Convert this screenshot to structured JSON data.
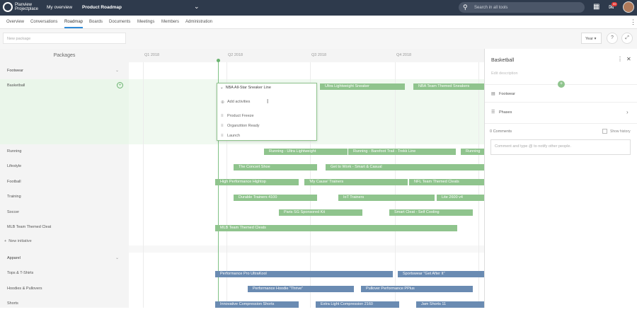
{
  "app": {
    "brand_line1": "Planview",
    "brand_line2": "Projectplace",
    "my_overview": "My overview",
    "project": "Product Roadmap",
    "search_placeholder": "Search in all tools",
    "notif_count": "99"
  },
  "tabs": [
    "Overview",
    "Conversations",
    "Roadmap",
    "Boards",
    "Documents",
    "Meetings",
    "Members",
    "Administration"
  ],
  "toolbar": {
    "new_package_placeholder": "New package",
    "zoom": "Year"
  },
  "left": {
    "header": "Packages",
    "rows": [
      "Footwear",
      "Basketball",
      "Running",
      "Lifestyle",
      "Football",
      "Training",
      "Soccer",
      "MLB Team Themed Cleat",
      "New initiative",
      "Apparel",
      "Tops & T-Shirts",
      "Hoodies & Pullovers",
      "Shorts"
    ]
  },
  "quarters": [
    "Q1 2018",
    "Q2 2018",
    "Q3 2018",
    "Q4 2018"
  ],
  "bars": [
    "NBA All-Star Sneaker Line",
    "Ultra Lightweight Sneaker",
    "NBA Team Themed Sneakers",
    "Running - Ultra Lightweight",
    "Running - Barefoot Trail - Trekk Line",
    "Running",
    "The Concert Shoe",
    "Get to Work - Smart & Casual",
    "High Performance Hightop",
    "'My Cause' Trainers",
    "NFL Team Themed Cleats",
    "Durable Trainers 4100",
    "IoT Trainers",
    "Lite 2600 v4",
    "Paris SG Sponsored Kit",
    "Smart Cleat - Self Cooling",
    "MLB Team Themed Cleats",
    "Performance Pro UltraKool",
    "Sportswear \"Get After It\"",
    "Performance Hoodie \"Thrive\"",
    "Pullover Performance PPlus",
    "Innovative Compression Shorts",
    "Extra Light Compression 2160",
    "Jam Shorts 11"
  ],
  "popup": {
    "title": "NBA All-Star Sneaker Line",
    "add": "Add activities",
    "items": [
      "Product Freeze",
      "Organzition Ready",
      "Launch"
    ]
  },
  "panel": {
    "title": "Basketball",
    "desc": "Edit description",
    "parent": "Footwear",
    "phases": "Phases",
    "comments": "0 Comments",
    "show_history": "Show history",
    "comment_placeholder": "Comment and type @ to notify other people."
  },
  "colors": {
    "topbar": "#2e3a4c",
    "green_bar": "#8fc48d",
    "blue_bar": "#6a8bb2",
    "accent": "#2e8bd8"
  }
}
